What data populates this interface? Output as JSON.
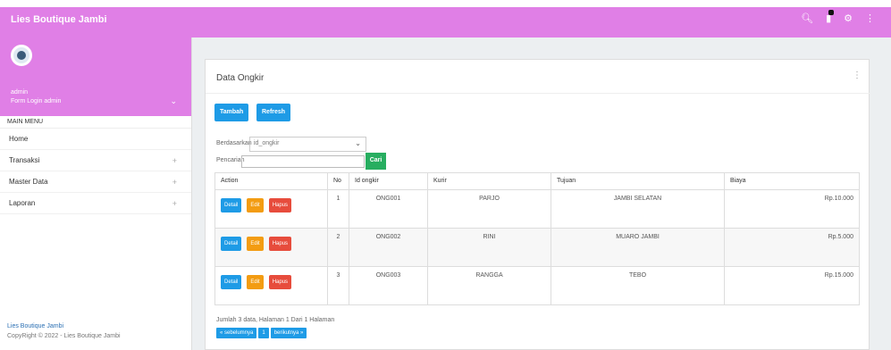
{
  "app": {
    "title": "Lies Boutique Jambi"
  },
  "topbar": {
    "icons": [
      "search-icon",
      "bell-icon",
      "settings-icon",
      "more-vertical-icon"
    ]
  },
  "sidebar": {
    "user_name": "admin",
    "user_role": "Form Login admin",
    "menu_header": "MAIN MENU",
    "items": [
      {
        "label": "Home"
      },
      {
        "label": "Transaksi",
        "expand": "+"
      },
      {
        "label": "Master Data",
        "expand": "+"
      },
      {
        "label": "Laporan",
        "expand": "+"
      }
    ],
    "footer_brand": "Lies Boutique Jambi",
    "footer_copy": "CopyRight © 2022 - Lies Boutique Jambi"
  },
  "card": {
    "title": "Data Ongkir",
    "tambah_label": "Tambah",
    "refresh_label": "Refresh",
    "berdasarkan_label": "Berdasarkan :",
    "berdasarkan_value": "id_ongkir",
    "pencarian_label": "Pencarian",
    "cari_label": "Cari"
  },
  "table": {
    "headers": [
      "Action",
      "No",
      "Id ongkir",
      "Kurir",
      "Tujuan",
      "Biaya"
    ],
    "action_labels": {
      "detail": "Detail",
      "edit": "Edit",
      "hapus": "Hapus"
    },
    "rows": [
      {
        "no": "1",
        "id": "ONG001",
        "kurir": "PARJO",
        "tujuan": "JAMBI SELATAN",
        "biaya": "Rp.10.000"
      },
      {
        "no": "2",
        "id": "ONG002",
        "kurir": "RINI",
        "tujuan": "MUARO JAMBI",
        "biaya": "Rp.5.000"
      },
      {
        "no": "3",
        "id": "ONG003",
        "kurir": "RANGGA",
        "tujuan": "TEBO",
        "biaya": "Rp.15.000"
      }
    ]
  },
  "pagination": {
    "info": "Jumlah 3 data, Halaman 1 Dari 1 Halaman",
    "prev": "« sebelumnya",
    "page": "1",
    "next": "berikutnya »"
  }
}
